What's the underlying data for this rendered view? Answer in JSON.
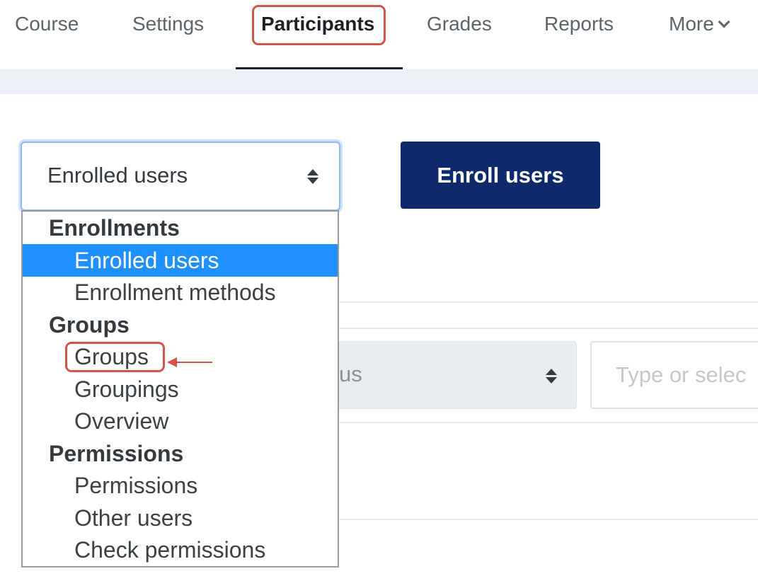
{
  "nav": {
    "tabs": [
      {
        "label": "Course"
      },
      {
        "label": "Settings"
      },
      {
        "label": "Participants"
      },
      {
        "label": "Grades"
      },
      {
        "label": "Reports"
      },
      {
        "label": "More"
      }
    ],
    "active_tab": "Participants"
  },
  "enrol_select": {
    "value": "Enrolled users"
  },
  "enroll_button": {
    "label": "Enroll users"
  },
  "filter": {
    "partial_select_text": "us",
    "type_placeholder": "Type or selec"
  },
  "dropdown": {
    "options": [
      {
        "label": "Enrollments",
        "kind": "group"
      },
      {
        "label": "Enrolled users",
        "kind": "item",
        "selected": true
      },
      {
        "label": "Enrollment methods",
        "kind": "item"
      },
      {
        "label": "Groups",
        "kind": "group"
      },
      {
        "label": "Groups",
        "kind": "item",
        "highlighted": true
      },
      {
        "label": "Groupings",
        "kind": "item"
      },
      {
        "label": "Overview",
        "kind": "item"
      },
      {
        "label": "Permissions",
        "kind": "group"
      },
      {
        "label": "Permissions",
        "kind": "item"
      },
      {
        "label": "Other users",
        "kind": "item"
      },
      {
        "label": "Check permissions",
        "kind": "item"
      }
    ]
  },
  "colors": {
    "highlight": "#d2554a",
    "selected_bg": "#1e90ff",
    "button_bg": "#0f2a6b",
    "band_bg": "#eef0f7"
  }
}
